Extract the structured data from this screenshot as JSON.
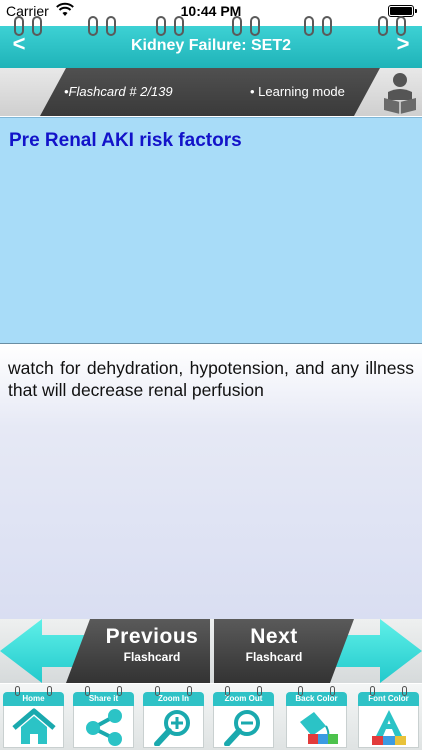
{
  "status_bar": {
    "carrier": "Carrier",
    "time": "10:44 PM"
  },
  "header": {
    "title": "Kidney Failure: SET2",
    "prev_label": "<",
    "next_label": ">",
    "bar_color": "#25bdc1"
  },
  "info": {
    "flashcard": "•Flashcard #  2/139",
    "mode": "• Learning mode"
  },
  "card": {
    "question": "Pre Renal AKI risk factors",
    "answer": "watch for dehydration, hypotension, and any illness that will decrease renal perfusion",
    "question_color": "#1313c9",
    "question_bg": "#a8dcf8"
  },
  "navigation": {
    "previous": {
      "line1": "Previous",
      "line2": "Flashcard"
    },
    "next": {
      "line1": "Next",
      "line2": "Flashcard"
    }
  },
  "toolbar": {
    "items": [
      {
        "label": "Home",
        "icon": "home-icon"
      },
      {
        "label": "Share it",
        "icon": "share-icon"
      },
      {
        "label": "Zoom In",
        "icon": "zoom-in-icon"
      },
      {
        "label": "Zoom Out",
        "icon": "zoom-out-icon"
      },
      {
        "label": "Back Color",
        "icon": "back-color-icon"
      },
      {
        "label": "Font Color",
        "icon": "font-color-icon"
      }
    ]
  }
}
